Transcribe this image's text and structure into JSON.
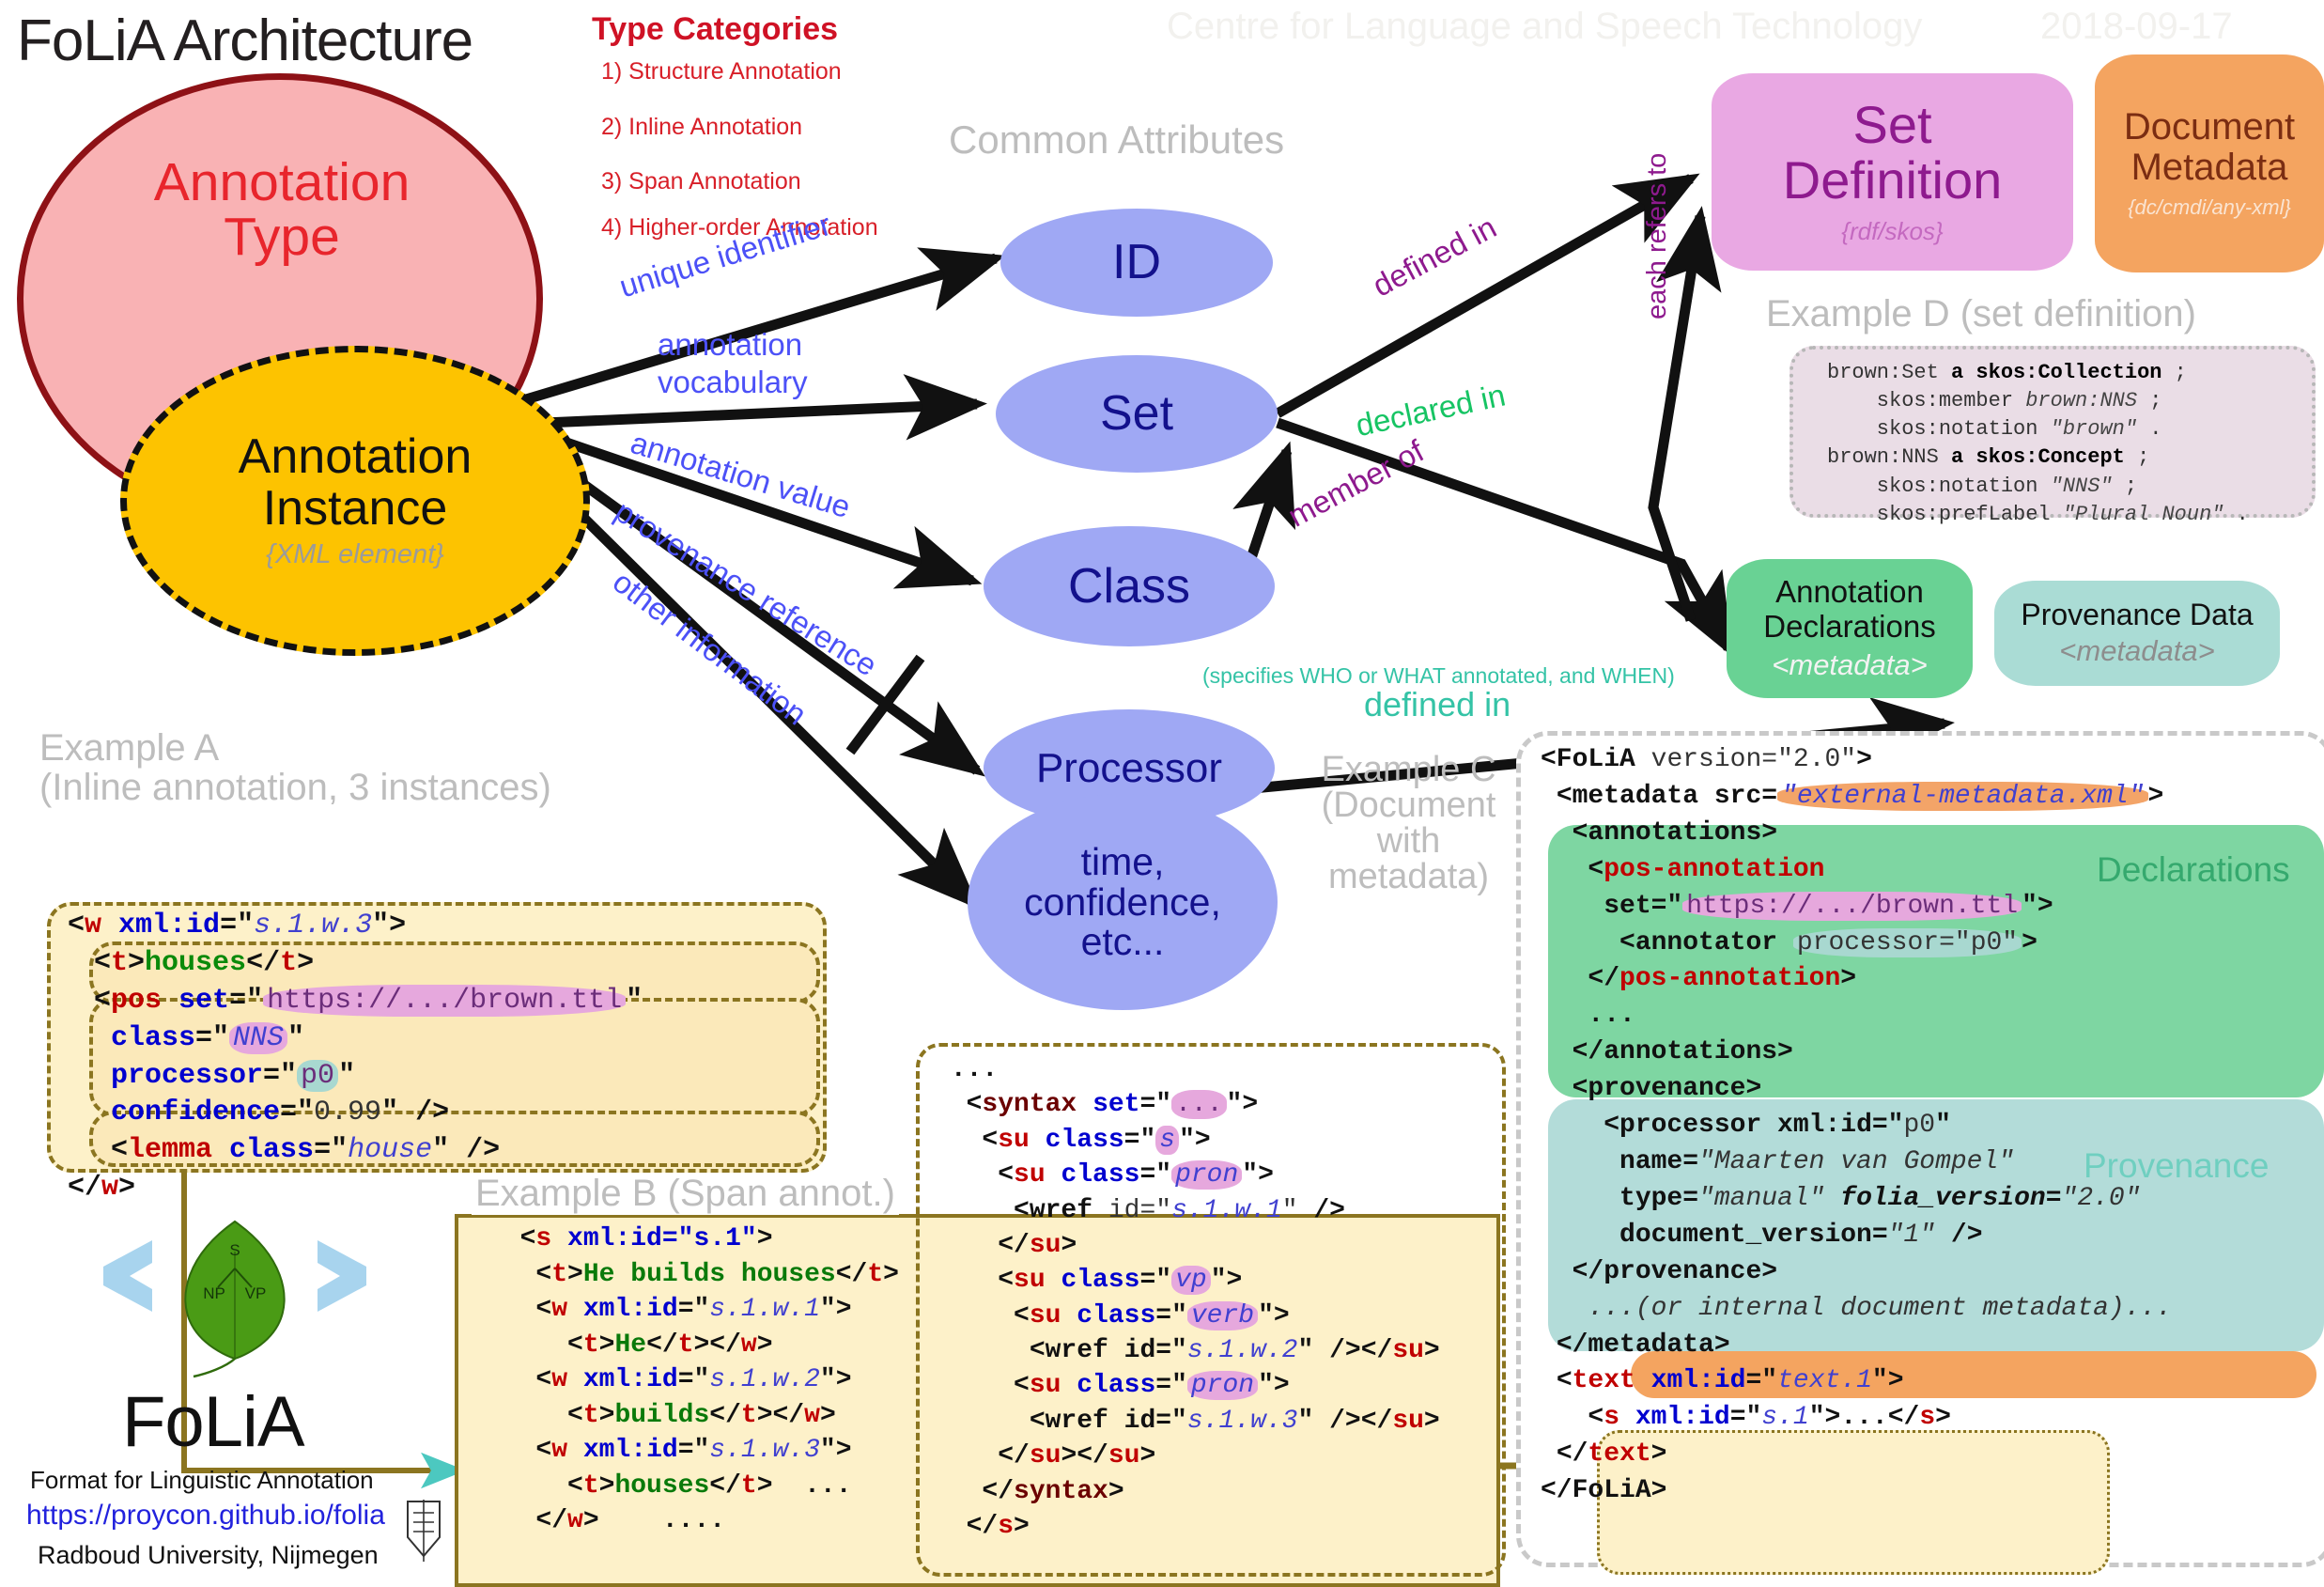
{
  "header": {
    "title": "FoLiA Architecture",
    "institute": "Centre for Language and Speech Technology",
    "date": "2018-09-17"
  },
  "type_categories": {
    "heading": "Type Categories",
    "items": [
      "1) Structure Annotation",
      "2) Inline Annotation",
      "3) Span Annotation",
      "4) Higher-order Annotation"
    ]
  },
  "annotation_type": {
    "label_line1": "Annotation",
    "label_line2": "Type"
  },
  "annotation_instance": {
    "label_line1": "Annotation",
    "label_line2": "Instance",
    "sublabel": "{XML element}"
  },
  "common_attributes": {
    "heading": "Common Attributes",
    "nodes": [
      {
        "label": "ID"
      },
      {
        "label": "Set"
      },
      {
        "label": "Class"
      },
      {
        "label": "Processor"
      },
      {
        "line1": "time,",
        "line2": "confidence,",
        "line3": "etc..."
      }
    ]
  },
  "edge_labels": {
    "unique_identifier": "unique identifier",
    "annotation_vocabulary_l1": "annotation",
    "annotation_vocabulary_l2": "vocabulary",
    "annotation_value": "annotation value",
    "provenance_reference": "provenance reference",
    "other_information": "other information",
    "defined_in_setdef": "defined in",
    "declared_in": "declared in",
    "member_of": "member of",
    "each_refers_to": "each refers to",
    "defined_in_prov": "defined in",
    "who_what_when": "(specifies WHO or WHAT annotated, and WHEN)"
  },
  "set_definition": {
    "title_l1": "Set",
    "title_l2": "Definition",
    "sub": "{rdf/skos}"
  },
  "document_metadata": {
    "title_l1": "Document",
    "title_l2": "Metadata",
    "sub": "{dc/cmdi/any-xml}"
  },
  "annotation_declarations": {
    "title_l1": "Annotation",
    "title_l2": "Declarations",
    "sub": "<metadata>"
  },
  "provenance_data": {
    "title": "Provenance Data",
    "sub": "<metadata>"
  },
  "example_d": {
    "caption": "Example D (set definition)",
    "lines": [
      "brown:Set a skos:Collection ;",
      "    skos:member brown:NNS ;",
      "    skos:notation \"brown\" .",
      "brown:NNS a skos:Concept ;",
      "    skos:notation \"NNS\" ;",
      "    skos:prefLabel \"Plural Noun\" ."
    ]
  },
  "example_a": {
    "caption_l1": "Example A",
    "caption_l2": "(Inline annotation, 3 instances)",
    "lines": [
      "<w xml:id=\"s.1.w.3\">",
      "<t>houses</t>",
      "<pos set=\"https://.../brown.ttl\"",
      " class=\"NNS\"",
      " processor=\"p0\"",
      " confidence=\"0.99\" />",
      "<lemma class=\"house\" />",
      "</w>"
    ]
  },
  "example_b": {
    "caption": "Example B (Span annot.)",
    "left_lines": [
      "<s xml:id=\"s.1\">",
      "  <t>He builds houses</t>",
      "  <w xml:id=\"s.1.w.1\">",
      "    <t>He</t></w>",
      "  <w xml:id=\"s.1.w.2\">",
      "    <t>builds</t></w>",
      "  <w xml:id=\"s.1.w.3\">",
      "    <t>houses</t>  ...",
      "  </w>    ...."
    ],
    "right_lines": [
      "...",
      " <syntax set=\"...\">",
      "  <su class=\"s\">",
      "   <su class=\"pron\">",
      "    <wref id=\"s.1.w.1\" />",
      "   </su>",
      "   <su class=\"vp\">",
      "    <su class=\"verb\">",
      "     <wref id=\"s.1.w.2\" /></su>",
      "    <su class=\"pron\">",
      "     <wref id=\"s.1.w.3\" /></su>",
      "   </su></su>",
      "  </syntax>",
      " </s>"
    ]
  },
  "example_c": {
    "caption_l1": "Example C",
    "caption_l2": "(Document",
    "caption_l3": "with",
    "caption_l4": "metadata)",
    "declarations_label": "Declarations",
    "provenance_label": "Provenance",
    "lines": [
      "<FoLiA version=\"2.0\">",
      " <metadata src=\"external-metadata.xml\">",
      "  <annotations>",
      "   <pos-annotation",
      "    set=\"https://.../brown.ttl\">",
      "     <annotator processor=\"p0\">",
      "   </pos-annotation>",
      "   ...",
      "  </annotations>",
      "  <provenance>",
      "    <processor xml:id=\"p0\"",
      "     name=\"Maarten van Gompel\"",
      "     type=\"manual\" folia_version=\"2.0\"",
      "     document_version=\"1\" />",
      "  </provenance>",
      "  ...(or internal document metadata)...",
      " </metadata>",
      " <text xml:id=\"text.1\">",
      "   <s xml:id=\"s.1\">...</s>",
      " </text>",
      "</FoLiA>"
    ]
  },
  "logo": {
    "leaf_labels": [
      "S",
      "NP",
      "VP"
    ],
    "name": "FoLiA",
    "tagline": "Format for Linguistic Annotation",
    "url": "https://proycon.github.io/folia",
    "affiliation": "Radboud University, Nijmegen"
  },
  "colors": {
    "annotation_type": "#f9b2b4",
    "annotation_type_border": "#8e1116",
    "annotation_instance": "#fdc300",
    "attribute": "#9fa8f4",
    "set_definition": "#e9a8e3",
    "document_metadata": "#f4a460",
    "annotation_declarations": "#69d294",
    "provenance_data": "#aadcd5",
    "code_bg": "#fdf1c9",
    "red": "#d81f28",
    "blue_label": "#4c51f7",
    "purple_label": "#8e1a8e",
    "green_label": "#16c463",
    "teal_label": "#34c3a6"
  }
}
